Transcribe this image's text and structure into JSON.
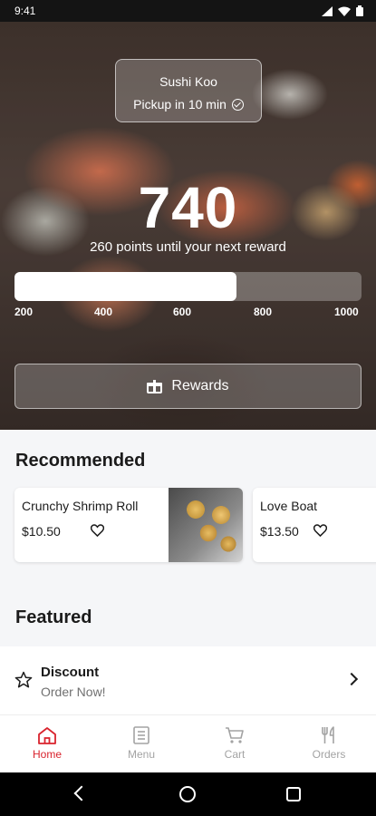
{
  "status_bar": {
    "time": "9:41"
  },
  "store": {
    "name": "Sushi Koo",
    "pickup": "Pickup in 10 min"
  },
  "points": {
    "value": "740",
    "subtitle": "260 points until your next reward",
    "progress_fraction": 0.64,
    "ticks": [
      "200",
      "400",
      "600",
      "800",
      "1000"
    ]
  },
  "rewards_button": {
    "label": "Rewards",
    "icon": "gift-icon"
  },
  "recommended": {
    "title": "Recommended",
    "items": [
      {
        "name": "Crunchy Shrimp Roll",
        "price": "$10.50",
        "icon": "heart-icon"
      },
      {
        "name": "Love Boat",
        "price": "$13.50",
        "icon": "heart-icon"
      }
    ]
  },
  "featured": {
    "title": "Featured",
    "items": [
      {
        "title": "Discount",
        "subtitle": "Order Now!",
        "icon": "star-icon"
      }
    ]
  },
  "tabs": [
    {
      "label": "Home",
      "icon": "home-icon",
      "active": true
    },
    {
      "label": "Menu",
      "icon": "menu-icon",
      "active": false
    },
    {
      "label": "Cart",
      "icon": "cart-icon",
      "active": false
    },
    {
      "label": "Orders",
      "icon": "utensils-icon",
      "active": false
    }
  ],
  "colors": {
    "accent": "#d9232d",
    "inactive": "#a3a3a3",
    "background": "#f5f6f8"
  }
}
